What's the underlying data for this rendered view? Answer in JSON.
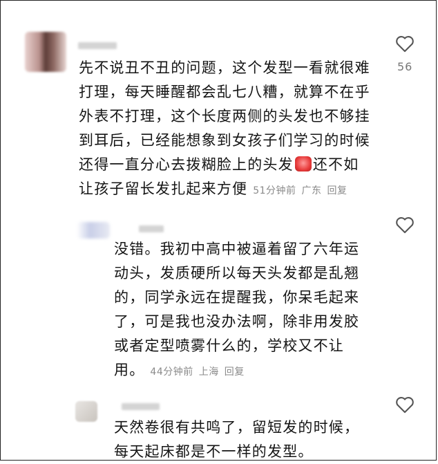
{
  "comments": [
    {
      "lines": [
        "先不说丑不丑的问题，这个发型一看就很难",
        "打理，每天睡醒都会乱七八糟，就算不在乎",
        "外表不打理，这个长度两侧的头发也不够挂",
        "到耳后，已经能想象到女孩子们学习的时候",
        "还得一直分心去拨糊脸上的头发",
        "让孩子留长发扎起来方便"
      ],
      "line5_suffix": "还不如",
      "time": "51分钟前",
      "location": "广东",
      "reply_label": "回复",
      "likes": "56"
    },
    {
      "lines": [
        "没错。我初中高中被逼着留了六年运",
        "动头，发质硬所以每天头发都是乱翘",
        "的，同学永远在提醒我，你呆毛起来",
        "了，可是我也没办法啊，除非用发胶",
        "或者定型喷雾什么的，学校又不让",
        "用。"
      ],
      "time": "44分钟前",
      "location": "上海",
      "reply_label": "回复"
    },
    {
      "lines": [
        "天然卷很有共鸣了，留短发的时候，",
        "每天起床都是不一样的发型。"
      ]
    }
  ],
  "icons": {
    "like": "heart-outline-icon",
    "emoji": "crying-face-emoji-icon"
  },
  "colors": {
    "text": "#151515",
    "meta": "#8a8a8a",
    "heart_stroke": "#555555"
  }
}
